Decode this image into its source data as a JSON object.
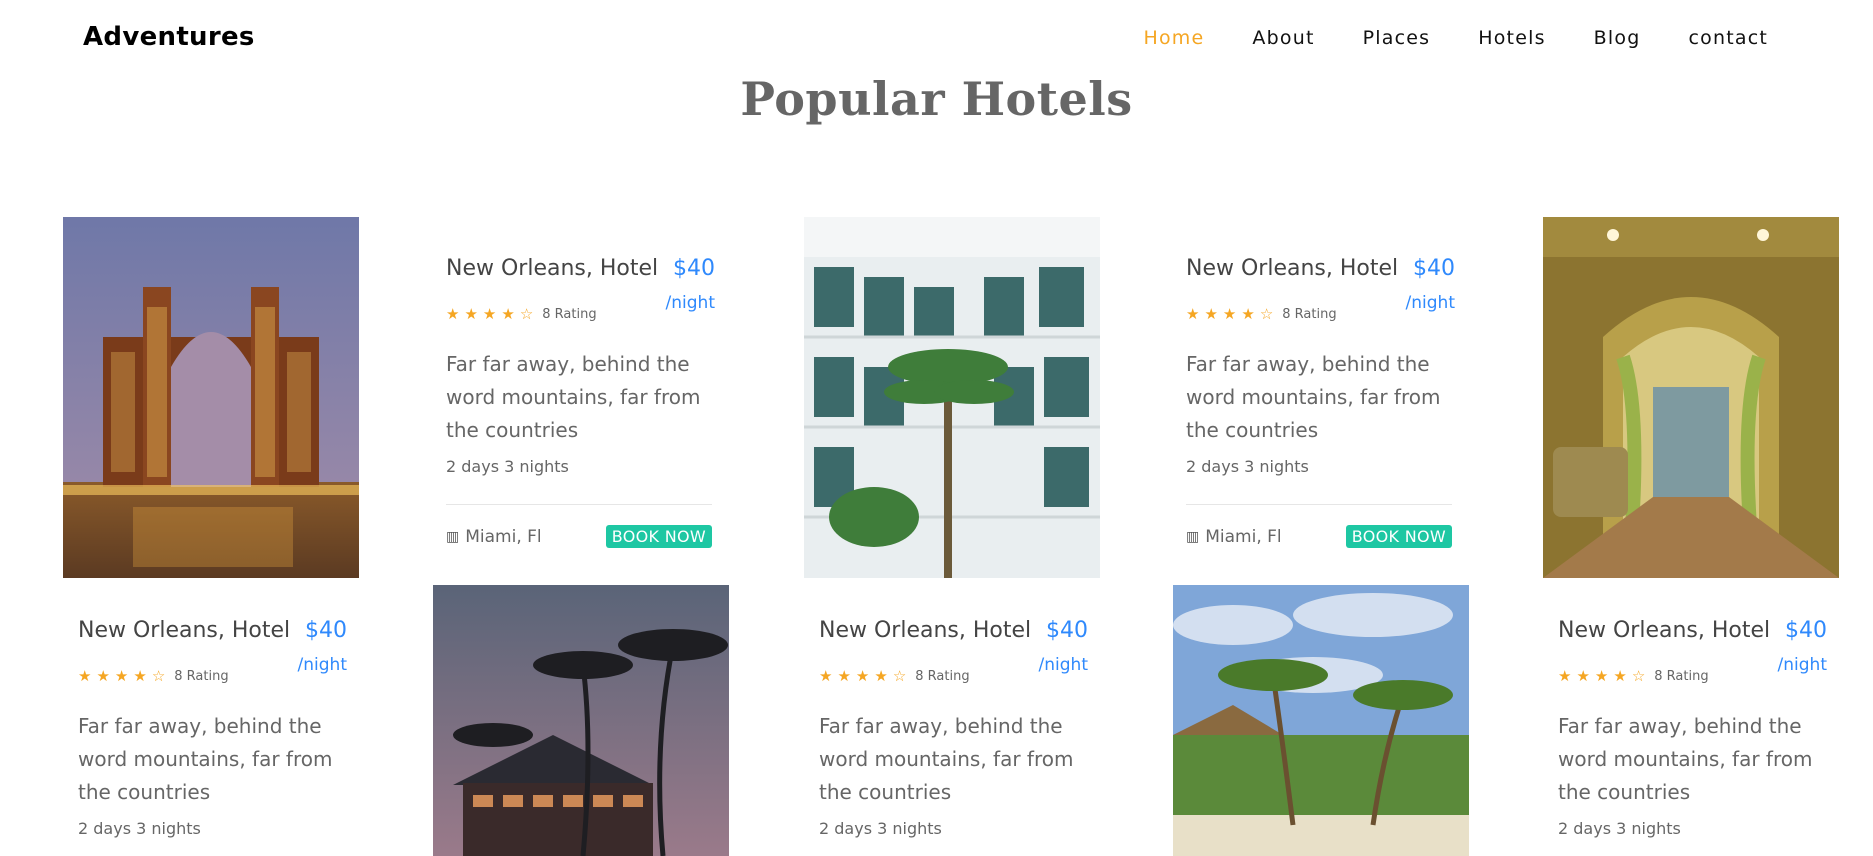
{
  "brand": "Adventures",
  "nav": [
    "Home",
    "About",
    "Places",
    "Hotels",
    "Blog",
    "contact"
  ],
  "section_title": "Popular Hotels",
  "hotel": {
    "name": "New Orleans, Hotel",
    "price": "$40",
    "per": "/night",
    "stars": 4,
    "rating_label": "8 Rating",
    "description": "Far far away, behind the word mountains, far from the countries",
    "duration": "2 days 3 nights",
    "location": "Miami, Fl",
    "book_label": "BOOK NOW"
  },
  "colors": {
    "accent": "#f5a623",
    "price": "#2f89fc",
    "button": "#1ec7a3"
  },
  "icons": {
    "star": "★",
    "star_empty": "☆",
    "location": "map-icon"
  }
}
